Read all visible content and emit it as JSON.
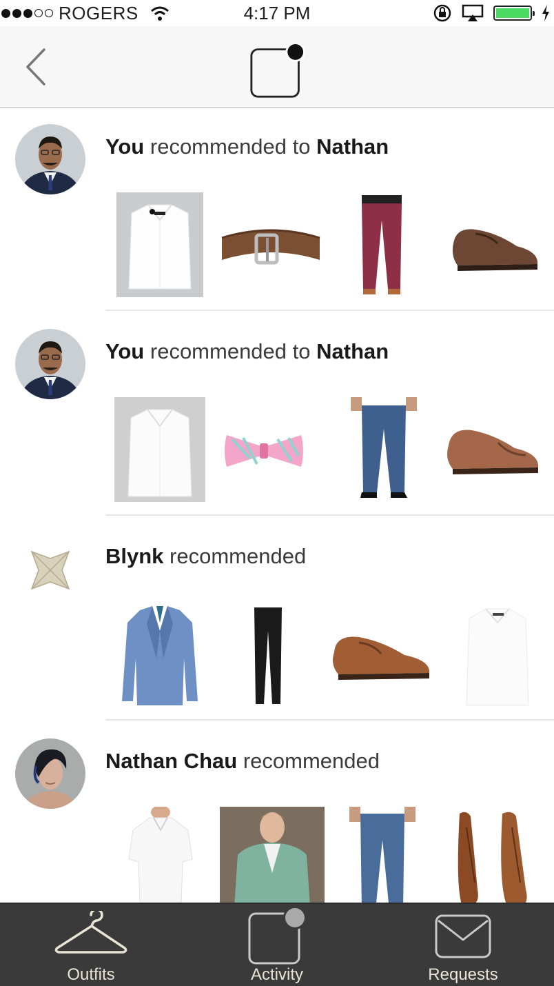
{
  "status_bar": {
    "carrier": "ROGERS",
    "time": "4:17 PM",
    "battery_level": 1.0
  },
  "nav": {
    "back_label": "Back"
  },
  "feed": [
    {
      "actor": "You",
      "verb": "recommended to",
      "target": "Nathan",
      "items": [
        "white-dress-shirt",
        "brown-leather-belt",
        "burgundy-chinos",
        "brown-cap-toe-shoes"
      ]
    },
    {
      "actor": "You",
      "verb": "recommended to",
      "target": "Nathan",
      "items": [
        "white-oxford-shirt",
        "pink-plaid-bow-tie",
        "blue-jeans",
        "brown-wingtip-shoes"
      ]
    },
    {
      "actor": "Blynk",
      "verb": "recommended",
      "target": "",
      "items": [
        "blue-blazer",
        "black-trousers",
        "brown-oxford-shoes",
        "white-dress-shirt"
      ]
    },
    {
      "actor": "Nathan Chau",
      "verb": "recommended",
      "target": "",
      "items": [
        "white-polo-shirt",
        "green-cardigan",
        "blue-jeans",
        "brown-leather-boots"
      ]
    }
  ],
  "tabs": [
    {
      "label": "Outfits",
      "icon": "hanger-icon"
    },
    {
      "label": "Activity",
      "icon": "activity-icon"
    },
    {
      "label": "Requests",
      "icon": "envelope-icon"
    }
  ],
  "colors": {
    "tabbar_bg": "#3a3a3a",
    "tab_icon": "#e9e4d6",
    "battery": "#4cd964"
  }
}
